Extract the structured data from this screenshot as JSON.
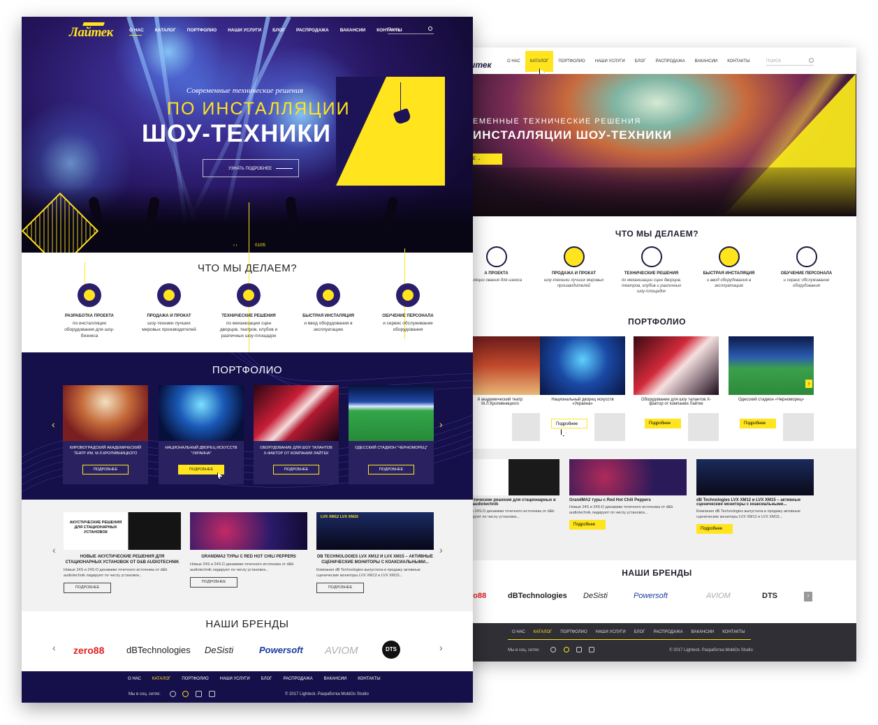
{
  "front": {
    "logo": "Лайтек",
    "nav": [
      "О НАС",
      "КАТАЛОГ",
      "ПОРТФОЛИО",
      "НАШИ УСЛУГИ",
      "БЛОГ",
      "РАСПРОДАЖА",
      "ВАКАНСИИ",
      "КОНТАКТЫ"
    ],
    "search_placeholder": "Поиск",
    "hero": {
      "subtitle": "Современные технические решения",
      "title_line1": "ПО ИНСТАЛЛЯЦИИ",
      "title_line2": "ШОУ-ТЕХНИКИ",
      "cta": "УЗНАТЬ ПОДРОБНЕЕ",
      "slide_counter": "01/05",
      "slide_arrows": "‹ ›"
    },
    "services_title": "ЧТО МЫ ДЕЛАЕМ?",
    "services": [
      {
        "name": "РАЗРАБОТКА ПРОЕКТА",
        "desc": "по инсталляции оборудования для шоу-бизнеса"
      },
      {
        "name": "ПРОДАЖА И ПРОКАТ",
        "desc": "шоу-техники лучших мировых производителей"
      },
      {
        "name": "ТЕХНИЧЕСКИЕ РЕШЕНИЯ",
        "desc": "по механизации сцен дворцов, театров, клубов и различных шоу-площадок"
      },
      {
        "name": "БЫСТРАЯ ИНСТАЛЯЦИЯ",
        "desc": "и ввод оборудования в эксплуатацию"
      },
      {
        "name": "ОБУЧЕНИЕ ПЕРСОНАЛА",
        "desc": "и сервис обслуживание оборудования"
      }
    ],
    "portfolio_title": "ПОРТФОЛИО",
    "portfolio": [
      {
        "caption": "КИРОВОГРАДСКИЙ АКАДЕМИЧЕСКИЙ ТЕАТР ИМ. М.Л.КРОПИВНИЦКОГО",
        "button": "ПОДРОБНЕЕ"
      },
      {
        "caption": "НАЦИОНАЛЬНЫЙ ДВОРЕЦ ИСКУССТВ \"УКРАИНА\"",
        "button": "ПОДРОБНЕЕ"
      },
      {
        "caption": "ОБОРУДОВАНИЕ ДЛЯ ШОУ ТАЛАНТОВ Х-ФАКТОР ОТ КОМПАНИИ ЛАЙТЕК",
        "button": "ПОДРОБНЕЕ"
      },
      {
        "caption": "ОДЕССКИЙ СТАДИОН \"ЧЕРНОМОРЕЦ\"",
        "button": "ПОДРОБНЕЕ"
      }
    ],
    "news": [
      {
        "banner": "АКУСТИЧЕСКИЕ РЕШЕНИЯ ДЛЯ СТАЦИОНАРНЫХ УСТАНОВОК",
        "title": "НОВЫЕ АКУСТИЧЕСКИЕ РЕШЕНИЯ ДЛЯ СТАЦИОНАРНЫХ УСТАНОВОК ОТ D&B AUDIOTECHNIK",
        "desc": "Новые 24S и 24S-D динамики точечного источника от d&b audiotechnik лидируют по числу установок...",
        "button": "ПОДРОБНЕЕ"
      },
      {
        "banner": "",
        "title": "GRANDMA2 ТУРЫ С RED HOT CHILI PEPPERS",
        "desc": "Новые 24S и 24S-D динамики точечного источника от d&b audiotechnik лидируют по числу установок...",
        "button": "ПОДРОБНЕЕ"
      },
      {
        "banner": "LVX XM12   LVX XM15",
        "title": "DB TECHNOLOGIES LVX XM12 И LVX XM15 – АКТИВНЫЕ СЦЕНИЧЕСКИЕ МОНИТОРЫ С КОАКСИАЛЬНЫМИ...",
        "desc": "Компания dB Technologies выпустила в продажу активные сценические мониторы LVX XM12 и LVX XM15...",
        "button": "ПОДРОБНЕЕ"
      }
    ],
    "brands_title": "НАШИ БРЕНДЫ",
    "brands": [
      "zero88",
      "dBTechnologies",
      "DeSisti",
      "Powersoft",
      "AVIOM",
      "DTS"
    ],
    "footer": {
      "nav": [
        "О НАС",
        "КАТАЛОГ",
        "ПОРТФОЛИО",
        "НАШИ УСЛУГИ",
        "БЛОГ",
        "РАСПРОДАЖА",
        "ВАКАНСИИ",
        "КОНТАКТЫ"
      ],
      "social_label": "Мы в соц. сетях:",
      "copyright": "© 2017 Lighteck. Разработка MobiOs Studio"
    }
  },
  "back": {
    "nav": [
      "О НАС",
      "КАТАЛОГ",
      "ПОРТФОЛИО",
      "НАШИ УСЛУГИ",
      "БЛОГ",
      "РАСПРОДАЖА",
      "ВАКАНСИИ",
      "КОНТАКТЫ"
    ],
    "search_placeholder": "ПОИСК",
    "hero": {
      "kicker": "ЕМЕННЫЕ ТЕХНИЧЕСКИЕ РЕШЕНИЯ",
      "title": "ИНСТАЛЛЯЦИИ ШОУ-ТЕХНИКИ"
    },
    "services_title": "ЧТО МЫ ДЕЛАЕМ?",
    "services": [
      {
        "name": "А ПРОЕКТА",
        "desc": "аляции ования для изнеса"
      },
      {
        "name": "ПРОДАЖА И ПРОКАТ",
        "desc": "шоу-техники лучших мировых производителей"
      },
      {
        "name": "ТЕХНИЧЕСКИЕ РЕШЕНИЯ",
        "desc": "по механизации сцен дворцов, театров, клубов и различных шоу-площадок"
      },
      {
        "name": "БЫСТРАЯ ИНСТАЛЯЦИЯ",
        "desc": "и ввод оборудования в эксплуатацию"
      },
      {
        "name": "ОБУЧЕНИЕ ПЕРСОНАЛА",
        "desc": "и сервис обслуживание оборудования"
      }
    ],
    "portfolio_title": "ПОРТФОЛИО",
    "portfolio": [
      {
        "caption": "й академический театр М.Л.Кропивницкого",
        "button": ""
      },
      {
        "caption": "Национальный дворец искусств «Украина»",
        "button": "Подробнее"
      },
      {
        "caption": "Оборудование для шоу талантов X-фактор от компании Лайтек",
        "button": "Подробнее"
      },
      {
        "caption": "Одесский стадион «Черноморец»",
        "button": "Подробнее"
      }
    ],
    "news": [
      {
        "title": "ые акустические решения для стационарных в от d&b audiotechnik",
        "desc": "ые 24S и 24S-D динамики точечного источника от d&b ruk лидируют по числу установок...",
        "button": ""
      },
      {
        "title": "GrandMA2 туры с Red Hot Chili Peppers",
        "desc": "Новые 24S и 24S-D динамики точечного источника от d&b audiotechnik лидируют по числу установок...",
        "button": "Подробнее"
      },
      {
        "title": "dB Technologies LVX XM12 и LVX XM15 – активные сценические мониторы с коаксиальными...",
        "desc": "Компания dB Technologies выпустила в продажу активные сценические мониторы LVX XM12 и LVX XM15...",
        "button": "Подробнее"
      }
    ],
    "brands_title": "НАШИ БРЕНДЫ",
    "brands": [
      "ro88",
      "dBTechnologies",
      "DeSisti",
      "Powersoft",
      "AVIOM",
      "DTS"
    ],
    "footer": {
      "nav": [
        "О НАС",
        "КАТАЛОГ",
        "ПОРТФОЛИО",
        "НАШИ УСЛУГИ",
        "БЛОГ",
        "РАСПРОДАЖА",
        "ВАКАНСИИ",
        "КОНТАКТЫ"
      ],
      "social_label": "Мы в соц. сетях:",
      "copyright": "© 2017 Lighteck. Разработка MobiOs Studio"
    }
  },
  "colors": {
    "accent": "#ffe41e",
    "navy": "#15104a",
    "dark_footer": "#2f2f35"
  }
}
